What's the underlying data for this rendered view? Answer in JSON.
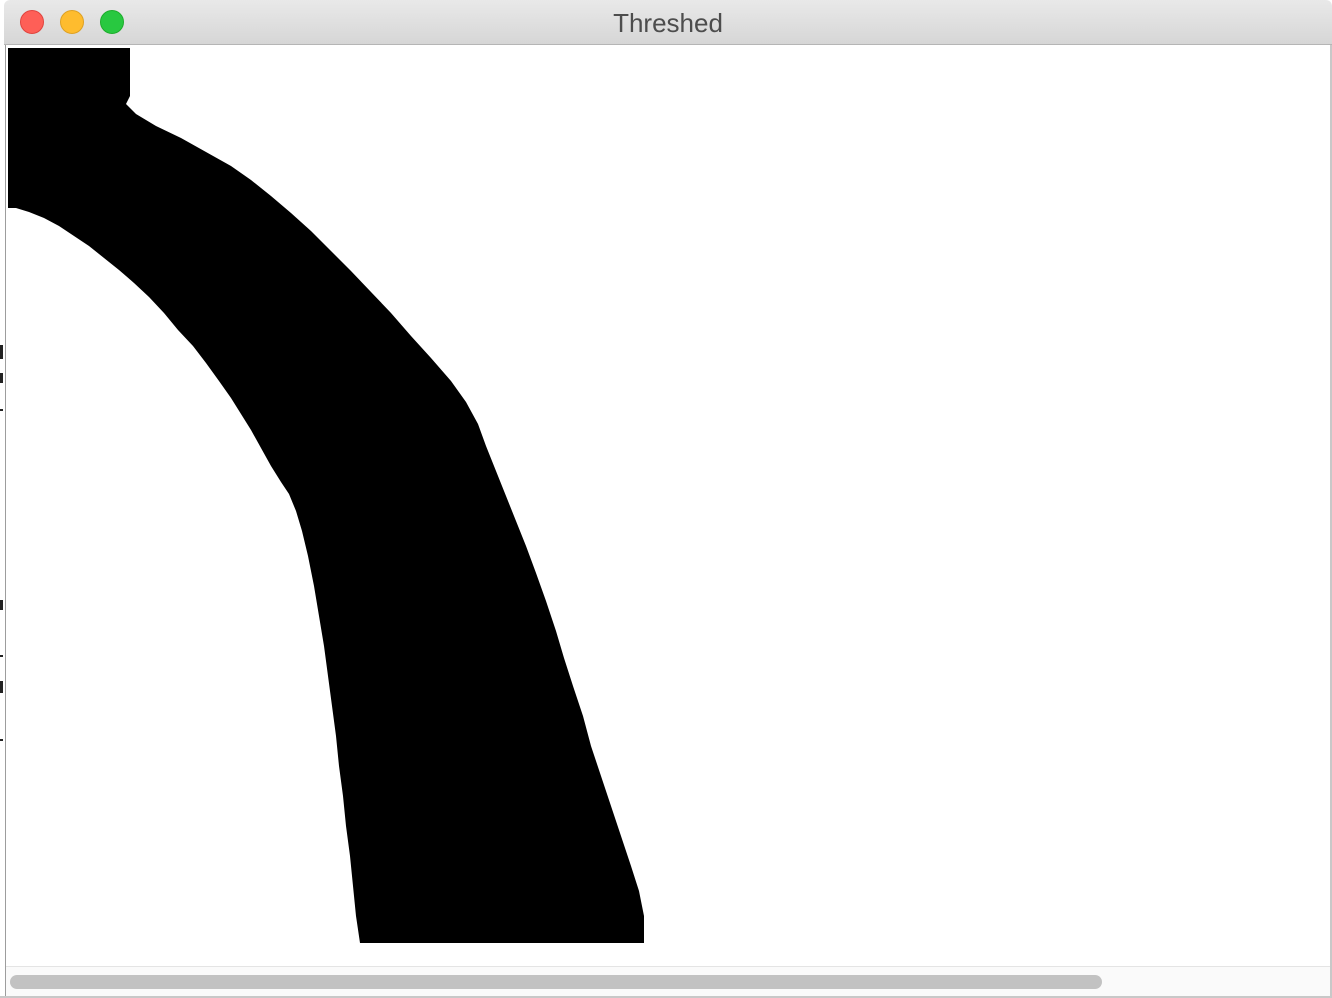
{
  "window": {
    "title": "Threshed"
  },
  "image": {
    "description_icon": "threshold-binary-image",
    "foreground_color": "#000000",
    "background_color": "#ffffff"
  },
  "scrollbar": {
    "horizontal_thumb_fraction": 0.83
  },
  "colors": {
    "close": "#fe5f57",
    "minimize": "#febc2e",
    "zoom": "#28c840"
  }
}
